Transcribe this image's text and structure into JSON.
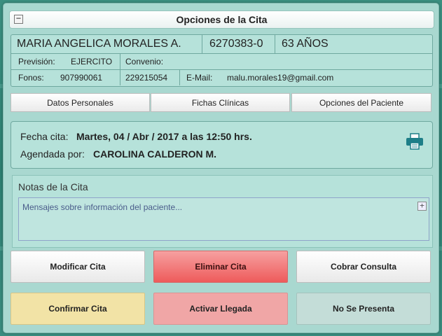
{
  "dialog": {
    "title": "Opciones de la Cita",
    "collapse_glyph": "−"
  },
  "patient": {
    "name": "MARIA ANGELICA MORALES A.",
    "rut": "6270383-0",
    "age": "63 AÑOS",
    "prevision_label": "Previsión:",
    "prevision_value": "EJERCITO",
    "convenio_label": "Convenio:",
    "convenio_value": "",
    "fonos_label": "Fonos:",
    "phone1": "907990061",
    "phone2": "229215054",
    "email_label": "E-Mail:",
    "email": "malu.morales19@gmail.com"
  },
  "tabs": [
    {
      "label": "Datos Personales"
    },
    {
      "label": "Fichas Clínicas"
    },
    {
      "label": "Opciones del Paciente"
    }
  ],
  "appointment": {
    "date_label": "Fecha cita:",
    "date_value": "Martes, 04 / Abr / 2017 a las 12:50 hrs.",
    "scheduled_label": "Agendada por:",
    "scheduled_value": "CAROLINA CALDERON M.",
    "print_icon": "printer-icon"
  },
  "notes": {
    "label": "Notas de la Cita",
    "placeholder": "Mensajes sobre información del paciente...",
    "expand_glyph": "+"
  },
  "actions": {
    "modify": "Modificar Cita",
    "delete": "Eliminar Cita",
    "charge": "Cobrar Consulta",
    "confirm": "Confirmar Cita",
    "arrival": "Activar Llegada",
    "noshow": "No Se Presenta"
  },
  "colors": {
    "panel": "#a9d8d0",
    "delete": "#ee5b5b",
    "confirm": "#f2e3a6",
    "arrival": "#f0a6a6",
    "noshow": "#c4ddd8",
    "print_icon": "#1e7f88"
  }
}
